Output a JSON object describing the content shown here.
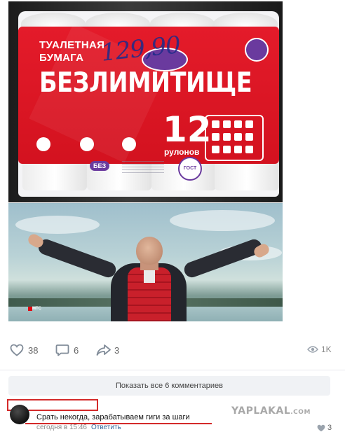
{
  "post": {
    "photos": [
      {
        "name": "toilet-paper-pack",
        "packaging": {
          "brand_line1": "ТУАЛЕТНАЯ",
          "brand_line2": "БУМАГА",
          "product_name": "БЕЗЛИМИТИЩЕ",
          "handwritten_price": "129,90",
          "roll_count": "12",
          "roll_unit": "рулонов",
          "badge": "БЕЗ",
          "gost_label": "ГОСТ"
        },
        "colors": {
          "packaging_red": "#e41b2a",
          "brand_purple": "#6a3a9e"
        }
      },
      {
        "name": "man-with-open-arms",
        "overlay_text": "МТС",
        "colors": {
          "vest_red": "#c9202b",
          "brand_red": "#e30611"
        }
      }
    ],
    "actions": {
      "likes": "38",
      "comments": "6",
      "shares": "3",
      "views": "1K"
    }
  },
  "comments": {
    "show_all_label": "Показать все 6 комментариев",
    "items": [
      {
        "text": "Срать некогда, зарабатываем гиги за шаги",
        "time": "сегодня в 15:46",
        "reply_label": "Ответить",
        "likes": "3"
      }
    ]
  },
  "watermark": {
    "text": "YAPLAKAL",
    "suffix": ".COM"
  },
  "highlight_color": "#d42a2a",
  "icons": [
    "heart-icon",
    "comment-icon",
    "share-icon",
    "eye-icon"
  ]
}
